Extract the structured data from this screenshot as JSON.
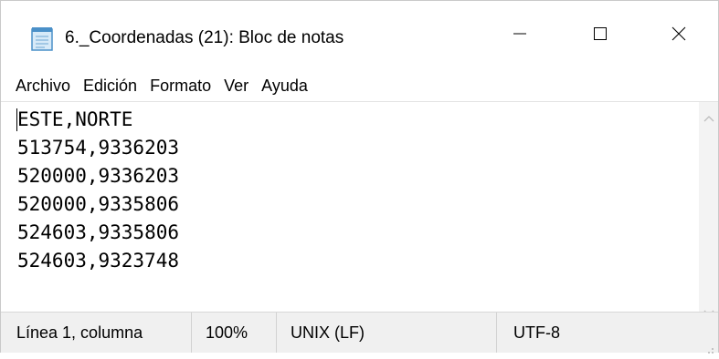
{
  "window": {
    "title": "6._Coordenadas (21): Bloc de notas",
    "app_icon": "notepad-icon",
    "controls": {
      "minimize_icon": "minimize-icon",
      "maximize_icon": "maximize-icon",
      "close_icon": "close-icon"
    }
  },
  "menu": {
    "items": [
      {
        "label": "Archivo"
      },
      {
        "label": "Edición"
      },
      {
        "label": "Formato"
      },
      {
        "label": "Ver"
      },
      {
        "label": "Ayuda"
      }
    ]
  },
  "editor": {
    "lines": [
      "ESTE,NORTE",
      "513754,9336203",
      "520000,9336203",
      "520000,9335806",
      "524603,9335806",
      "524603,9323748"
    ]
  },
  "statusbar": {
    "position": "Línea 1, columna",
    "zoom": "100%",
    "line_ending": "UNIX (LF)",
    "encoding": "UTF-8"
  },
  "colors": {
    "scroll_arrow": "#bdbdbd",
    "statusbar_bg": "#f0f0f0",
    "icon_blue": "#4a90c8"
  }
}
